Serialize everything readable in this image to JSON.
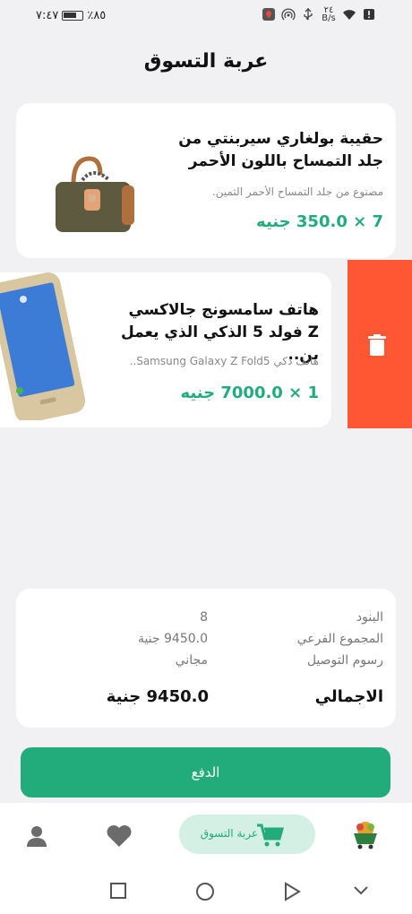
{
  "status_bar": {
    "time": "٧:٤٧",
    "battery_percent": "٪٨٥",
    "network_rate": "٢٤ B/s",
    "icons": [
      "battery-icon",
      "location-icon",
      "hotspot-icon",
      "usb-icon",
      "wifi-icon",
      "alert-icon"
    ]
  },
  "header": {
    "title": "عربة التسوق"
  },
  "cart_items": [
    {
      "name": "حقيبة بولغاري سيربنتي من جلد التمساح باللون الأحمر",
      "description": "مصنوع من جلد التمساح الأحمر الثمين.",
      "price_line": "7 × 350.0 جنيه",
      "image": "handbag-image"
    },
    {
      "name": "هاتف سامسونج جالاكسي Z فولد 5 الذكي الذي يعمل بن..",
      "description": "هاتف ذكي Samsung Galaxy Z Fold5..",
      "price_line": "1 × 7000.0 جنيه",
      "image": "phone-image"
    }
  ],
  "delete_action": {
    "icon": "trash-icon",
    "color": "#ff5733"
  },
  "summary": {
    "items_label": "البنود",
    "items_value": "8",
    "subtotal_label": "المجموع الفرعي",
    "subtotal_value": "9450.0 جنية",
    "delivery_label": "رسوم التوصيل",
    "delivery_value": "مجاني",
    "total_label": "الاجمالي",
    "total_value": "9450.0 جنية"
  },
  "pay_button": {
    "label": "الدفع"
  },
  "bottom_nav": {
    "cart_label": "عربة التسوق",
    "icons": [
      "profile-icon",
      "favorites-icon",
      "cart-icon",
      "home-logo-icon"
    ]
  },
  "colors": {
    "accent": "#22ab7b",
    "accent_light": "#d4efe4",
    "danger": "#ff5733"
  },
  "android_nav": [
    "square-icon",
    "circle-icon",
    "triangle-icon",
    "chevron-down-icon"
  ]
}
